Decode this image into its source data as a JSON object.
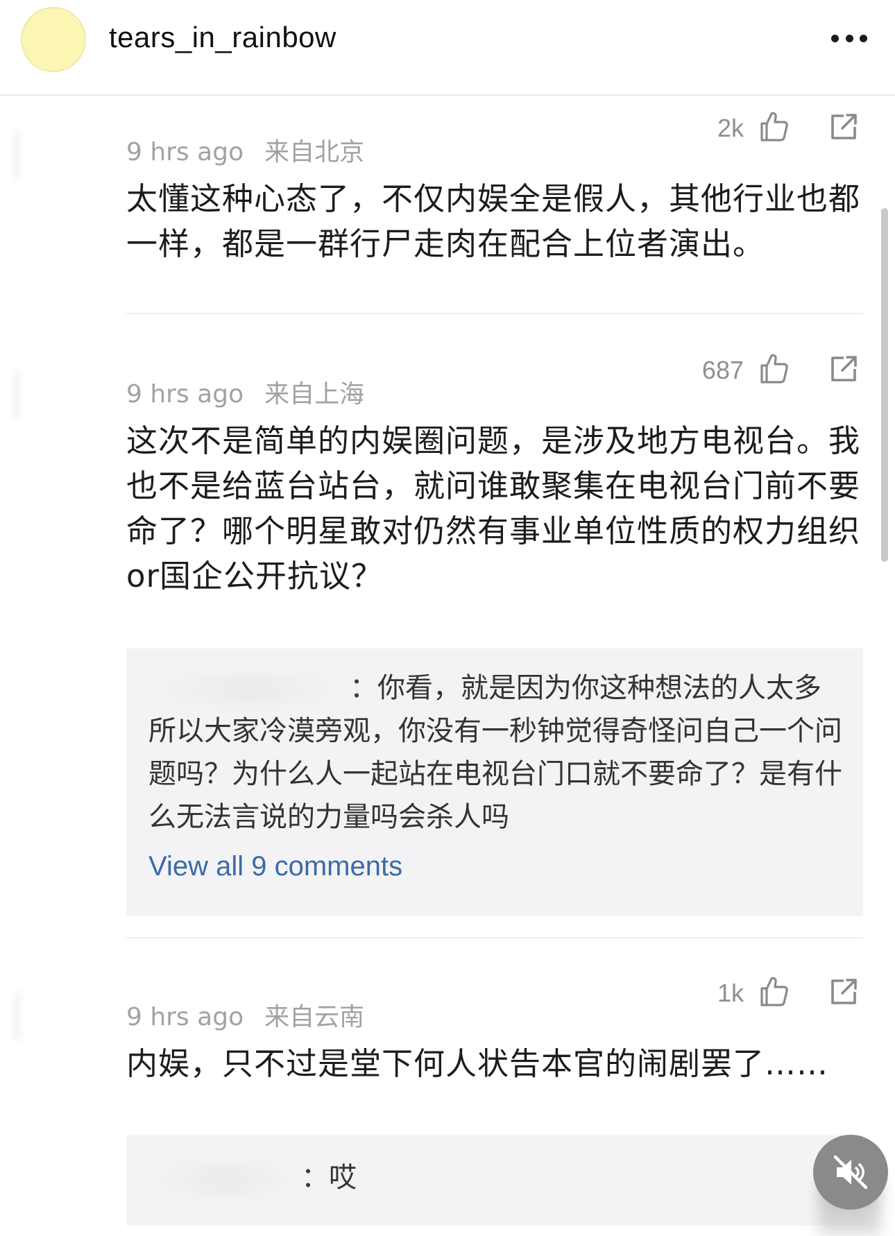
{
  "header": {
    "username": "tears_in_rainbow",
    "more_icon": "more-horizontal-icon"
  },
  "comments": [
    {
      "likes": "2k",
      "time": "9 hrs ago",
      "location": "来自北京",
      "text": "太懂这种心态了，不仅内娱全是假人，其他行业也都一样，都是一群行尸走肉在配合上位者演出。"
    },
    {
      "likes": "687",
      "time": "9 hrs ago",
      "location": "来自上海",
      "text": "这次不是简单的内娱圈问题，是涉及地方电视台。我也不是给蓝台站台，就问谁敢聚集在电视台门前不要命了？哪个明星敢对仍然有事业单位性质的权力组织or国企公开抗议？",
      "reply": {
        "text": "：你看，就是因为你这种想法的人太多所以大家冷漠旁观，你没有一秒钟觉得奇怪问自己一个问题吗？为什么人一起站在电视台门口就不要命了？是有什么无法言说的力量吗会杀人吗",
        "view_all": "View all 9 comments"
      }
    },
    {
      "likes": "1k",
      "time": "9 hrs ago",
      "location": "来自云南",
      "text": "内娱，只不过是堂下何人状告本官的闹剧罢了……",
      "reply": {
        "text": "：哎"
      }
    }
  ],
  "icons": {
    "like": "thumbs-up-icon",
    "share": "share-icon",
    "mute": "volume-mute-icon"
  }
}
